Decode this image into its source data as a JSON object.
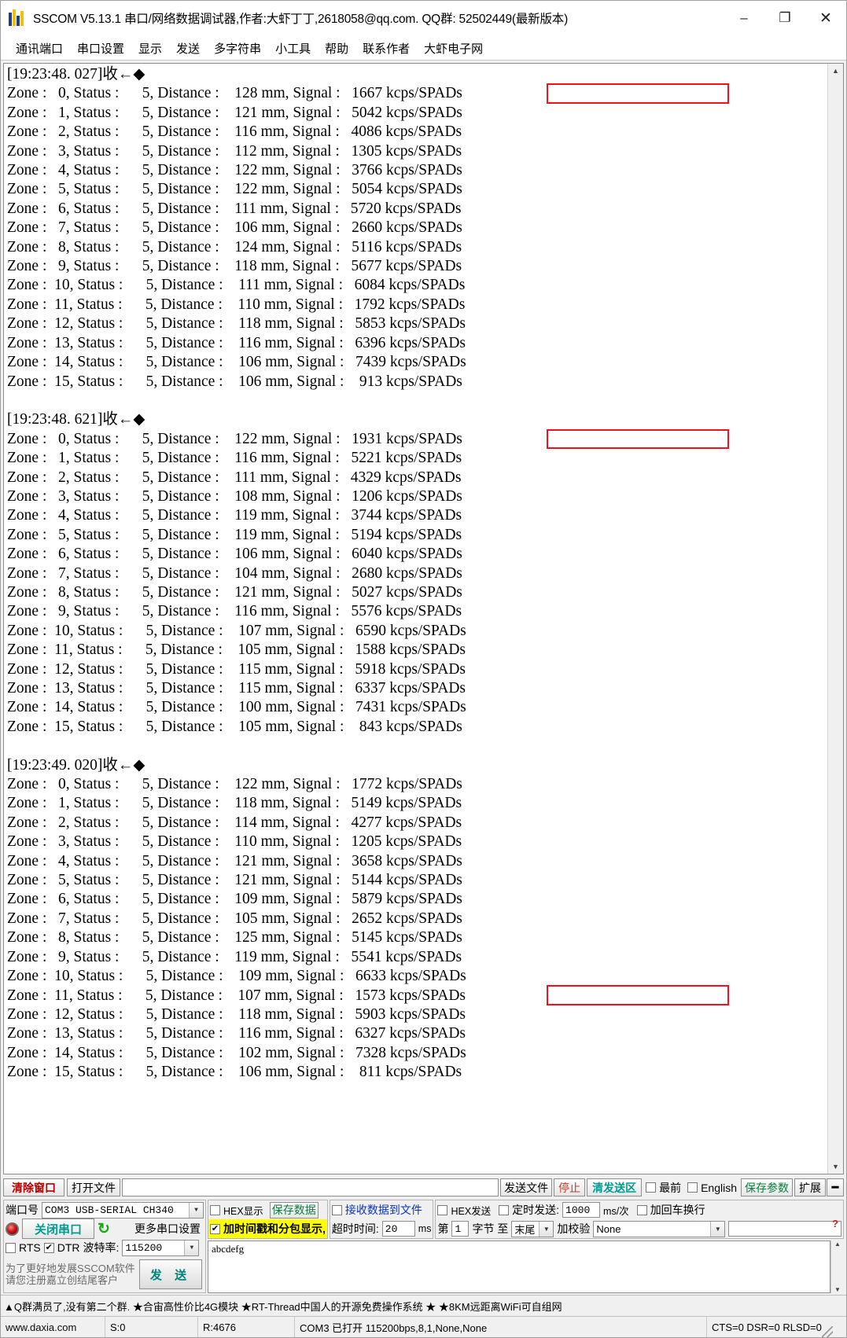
{
  "window": {
    "title": "SSCOM V5.13.1 串口/网络数据调试器,作者:大虾丁丁,2618058@qq.com. QQ群: 52502449(最新版本)",
    "minimize": "–",
    "maximize": "❐",
    "close": "✕"
  },
  "menu": {
    "items": [
      "通讯端口",
      "串口设置",
      "显示",
      "发送",
      "多字符串",
      "小工具",
      "帮助",
      "联系作者",
      "大虾电子网"
    ]
  },
  "terminal": {
    "blocks": [
      {
        "header": "[19:23:48. 027]收←◆",
        "rows": [
          {
            "zone": "0",
            "status": "5",
            "distance": "128",
            "signal": "1667",
            "highlight": true
          },
          {
            "zone": "1",
            "status": "5",
            "distance": "121",
            "signal": "5042",
            "highlight": false
          },
          {
            "zone": "2",
            "status": "5",
            "distance": "116",
            "signal": "4086",
            "highlight": false
          },
          {
            "zone": "3",
            "status": "5",
            "distance": "112",
            "signal": "1305",
            "highlight": false
          },
          {
            "zone": "4",
            "status": "5",
            "distance": "122",
            "signal": "3766",
            "highlight": false
          },
          {
            "zone": "5",
            "status": "5",
            "distance": "122",
            "signal": "5054",
            "highlight": false
          },
          {
            "zone": "6",
            "status": "5",
            "distance": "111",
            "signal": "5720",
            "highlight": false
          },
          {
            "zone": "7",
            "status": "5",
            "distance": "106",
            "signal": "2660",
            "highlight": false
          },
          {
            "zone": "8",
            "status": "5",
            "distance": "124",
            "signal": "5116",
            "highlight": false
          },
          {
            "zone": "9",
            "status": "5",
            "distance": "118",
            "signal": "5677",
            "highlight": false
          },
          {
            "zone": "10",
            "status": "5",
            "distance": "111",
            "signal": "6084",
            "highlight": false
          },
          {
            "zone": "11",
            "status": "5",
            "distance": "110",
            "signal": "1792",
            "highlight": false
          },
          {
            "zone": "12",
            "status": "5",
            "distance": "118",
            "signal": "5853",
            "highlight": false
          },
          {
            "zone": "13",
            "status": "5",
            "distance": "116",
            "signal": "6396",
            "highlight": false
          },
          {
            "zone": "14",
            "status": "5",
            "distance": "106",
            "signal": "7439",
            "highlight": false
          },
          {
            "zone": "15",
            "status": "5",
            "distance": "106",
            "signal": "913",
            "highlight": false
          }
        ]
      },
      {
        "header": "[19:23:48. 621]收←◆",
        "rows": [
          {
            "zone": "0",
            "status": "5",
            "distance": "122",
            "signal": "1931",
            "highlight": true
          },
          {
            "zone": "1",
            "status": "5",
            "distance": "116",
            "signal": "5221",
            "highlight": false
          },
          {
            "zone": "2",
            "status": "5",
            "distance": "111",
            "signal": "4329",
            "highlight": false
          },
          {
            "zone": "3",
            "status": "5",
            "distance": "108",
            "signal": "1206",
            "highlight": false
          },
          {
            "zone": "4",
            "status": "5",
            "distance": "119",
            "signal": "3744",
            "highlight": false
          },
          {
            "zone": "5",
            "status": "5",
            "distance": "119",
            "signal": "5194",
            "highlight": false
          },
          {
            "zone": "6",
            "status": "5",
            "distance": "106",
            "signal": "6040",
            "highlight": false
          },
          {
            "zone": "7",
            "status": "5",
            "distance": "104",
            "signal": "2680",
            "highlight": false
          },
          {
            "zone": "8",
            "status": "5",
            "distance": "121",
            "signal": "5027",
            "highlight": false
          },
          {
            "zone": "9",
            "status": "5",
            "distance": "116",
            "signal": "5576",
            "highlight": false
          },
          {
            "zone": "10",
            "status": "5",
            "distance": "107",
            "signal": "6590",
            "highlight": false
          },
          {
            "zone": "11",
            "status": "5",
            "distance": "105",
            "signal": "1588",
            "highlight": false
          },
          {
            "zone": "12",
            "status": "5",
            "distance": "115",
            "signal": "5918",
            "highlight": false
          },
          {
            "zone": "13",
            "status": "5",
            "distance": "115",
            "signal": "6337",
            "highlight": false
          },
          {
            "zone": "14",
            "status": "5",
            "distance": "100",
            "signal": "7431",
            "highlight": false
          },
          {
            "zone": "15",
            "status": "5",
            "distance": "105",
            "signal": "843",
            "highlight": false
          }
        ]
      },
      {
        "header": "[19:23:49. 020]收←◆",
        "rows": [
          {
            "zone": "0",
            "status": "5",
            "distance": "122",
            "signal": "1772",
            "highlight": false
          },
          {
            "zone": "1",
            "status": "5",
            "distance": "118",
            "signal": "5149",
            "highlight": false
          },
          {
            "zone": "2",
            "status": "5",
            "distance": "114",
            "signal": "4277",
            "highlight": false
          },
          {
            "zone": "3",
            "status": "5",
            "distance": "110",
            "signal": "1205",
            "highlight": false
          },
          {
            "zone": "4",
            "status": "5",
            "distance": "121",
            "signal": "3658",
            "highlight": false
          },
          {
            "zone": "5",
            "status": "5",
            "distance": "121",
            "signal": "5144",
            "highlight": false
          },
          {
            "zone": "6",
            "status": "5",
            "distance": "109",
            "signal": "5879",
            "highlight": false
          },
          {
            "zone": "7",
            "status": "5",
            "distance": "105",
            "signal": "2652",
            "highlight": false
          },
          {
            "zone": "8",
            "status": "5",
            "distance": "125",
            "signal": "5145",
            "highlight": false
          },
          {
            "zone": "9",
            "status": "5",
            "distance": "119",
            "signal": "5541",
            "highlight": false
          },
          {
            "zone": "10",
            "status": "5",
            "distance": "109",
            "signal": "6633",
            "highlight": false
          },
          {
            "zone": "11",
            "status": "5",
            "distance": "107",
            "signal": "1573",
            "highlight": true
          },
          {
            "zone": "12",
            "status": "5",
            "distance": "118",
            "signal": "5903",
            "highlight": false
          },
          {
            "zone": "13",
            "status": "5",
            "distance": "116",
            "signal": "6327",
            "highlight": false
          },
          {
            "zone": "14",
            "status": "5",
            "distance": "102",
            "signal": "7328",
            "highlight": false
          },
          {
            "zone": "15",
            "status": "5",
            "distance": "106",
            "signal": "811",
            "highlight": false
          }
        ]
      }
    ],
    "labels": {
      "zone": "Zone :",
      "status": "Status :",
      "distance": "Distance :",
      "mm": "mm,",
      "signal": "Signal :",
      "unit": "kcps/SPADs"
    }
  },
  "sendbar": {
    "clear_window": "清除窗口",
    "open_file": "打开文件",
    "file_path": "",
    "send_file": "发送文件",
    "stop": "停止",
    "clear_send": "清发送区",
    "topmost": "最前",
    "english": "English",
    "save_params": "保存参数",
    "extend": "扩展",
    "collapse": "━"
  },
  "serial": {
    "port_label": "端口号",
    "port_value": "COM3 USB-SERIAL CH340",
    "close_port": "关闭串口",
    "more_settings": "更多串口设置",
    "rts": "RTS",
    "dtr": "DTR",
    "baud_label": "波特率:",
    "baud_value": "115200",
    "promo_line1": "为了更好地发展SSCOM软件",
    "promo_line2": "请您注册嘉立创结尾客户",
    "send_button": "发 送"
  },
  "display_opts": {
    "hex_display": "HEX显示",
    "save_data": "保存数据",
    "recv_to_file": "接收数据到文件",
    "timestamp_pack": "加时间戳和分包显示,",
    "timeout_label": "超时时间:",
    "timeout_value": "20",
    "timeout_unit": "ms",
    "hex_send": "HEX发送",
    "timed_send": "定时发送:",
    "interval_value": "1000",
    "interval_unit": "ms/次",
    "crlf": "加回车换行",
    "byte_prefix": "第",
    "byte_index": "1",
    "byte_label": "字节 至",
    "byte_end": "末尾",
    "checksum_label": "加校验",
    "checksum_value": "None",
    "help_mark": "?"
  },
  "send_area": {
    "text": "abcdefg"
  },
  "adbar": {
    "text": "▲Q群满员了,没有第二个群. ★合宙高性价比4G模块 ★RT-Thread中国人的开源免费操作系统 ★ ★8KM远距离WiFi可自组网"
  },
  "statusbar": {
    "site": "www.daxia.com",
    "sent": "S:0",
    "received": "R:4676",
    "connection": "COM3 已打开  115200bps,8,1,None,None",
    "flow": "CTS=0 DSR=0 RLSD=0"
  }
}
